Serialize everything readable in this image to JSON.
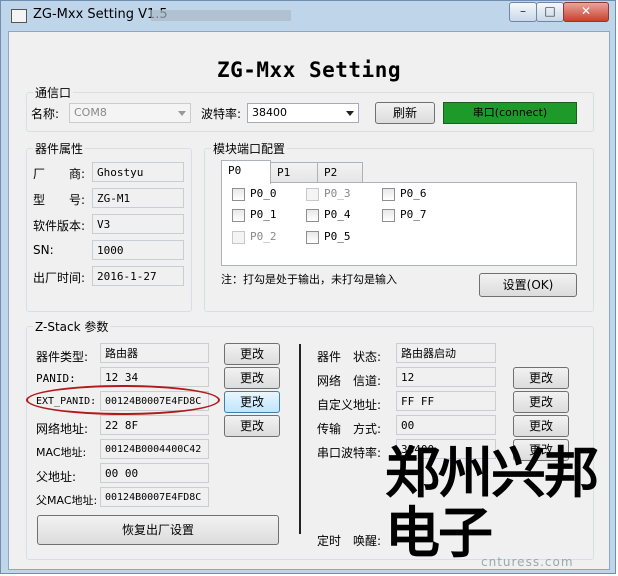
{
  "window": {
    "title": "ZG-Mxx Setting V1.5",
    "controls": {
      "minimize": "–",
      "maximize": "□",
      "close": "✕"
    }
  },
  "app_title": "ZG-Mxx Setting",
  "port": {
    "group_label": "通信口",
    "name_label": "名称:",
    "name_value": "COM8",
    "baud_label": "波特率:",
    "baud_value": "38400",
    "refresh_button": "刷新",
    "connect_button": "串口(connect)"
  },
  "device": {
    "group_label": "器件属性",
    "rows": [
      {
        "label": "厂　　商:",
        "value": "Ghostyu"
      },
      {
        "label": "型　　号:",
        "value": "ZG-M1"
      },
      {
        "label": "软件版本:",
        "value": "V3"
      },
      {
        "label": "SN:",
        "value": "1000"
      },
      {
        "label": "出厂时间:",
        "value": "2016-1-27"
      }
    ]
  },
  "module_port": {
    "group_label": "模块端口配置",
    "tabs": [
      "P0",
      "P1",
      "P2"
    ],
    "pins": [
      {
        "label": "P0_0",
        "disabled": false
      },
      {
        "label": "P0_1",
        "disabled": false
      },
      {
        "label": "P0_2",
        "disabled": true
      },
      {
        "label": "P0_3",
        "disabled": true
      },
      {
        "label": "P0_4",
        "disabled": false
      },
      {
        "label": "P0_5",
        "disabled": false
      },
      {
        "label": "P0_6",
        "disabled": false
      },
      {
        "label": "P0_7",
        "disabled": false
      }
    ],
    "note": "注：打勾是处于输出，未打勾是输入",
    "set_button": "设置(OK)"
  },
  "zstack": {
    "group_label": "Z-Stack 参数",
    "left_rows": [
      {
        "label": "器件类型:",
        "value": "路由器",
        "button": "更改"
      },
      {
        "label": "PANID:",
        "value": "12 34",
        "button": "更改"
      },
      {
        "label": "EXT_PANID:",
        "value": "00124B0007E4FD8C",
        "button": "更改"
      },
      {
        "label": "网络地址:",
        "value": "22 8F",
        "button": "更改"
      },
      {
        "label": "MAC地址:",
        "value": "00124B0004400C42"
      },
      {
        "label": "父地址:",
        "value": "00 00"
      },
      {
        "label": "父MAC地址:",
        "value": "00124B0007E4FD8C"
      }
    ],
    "restore_button": "恢复出厂设置",
    "right_rows": [
      {
        "label": "器件　状态:",
        "value": "路由器启动"
      },
      {
        "label": "网络　信道:",
        "value": "12",
        "button": "更改"
      },
      {
        "label": "自定义地址:",
        "value": "FF FF",
        "button": "更改"
      },
      {
        "label": "传输　方式:",
        "value": "00",
        "button": "更改"
      },
      {
        "label": "串口波特率:",
        "value": "38400",
        "button": "更改"
      }
    ],
    "timer_label": "定时　唤醒:"
  },
  "watermark": {
    "text": "郑州兴邦电子",
    "url": "cnturess.com"
  },
  "colors": {
    "connect_green": "#1e9a2a",
    "highlight_ellipse": "#b01a1a"
  }
}
